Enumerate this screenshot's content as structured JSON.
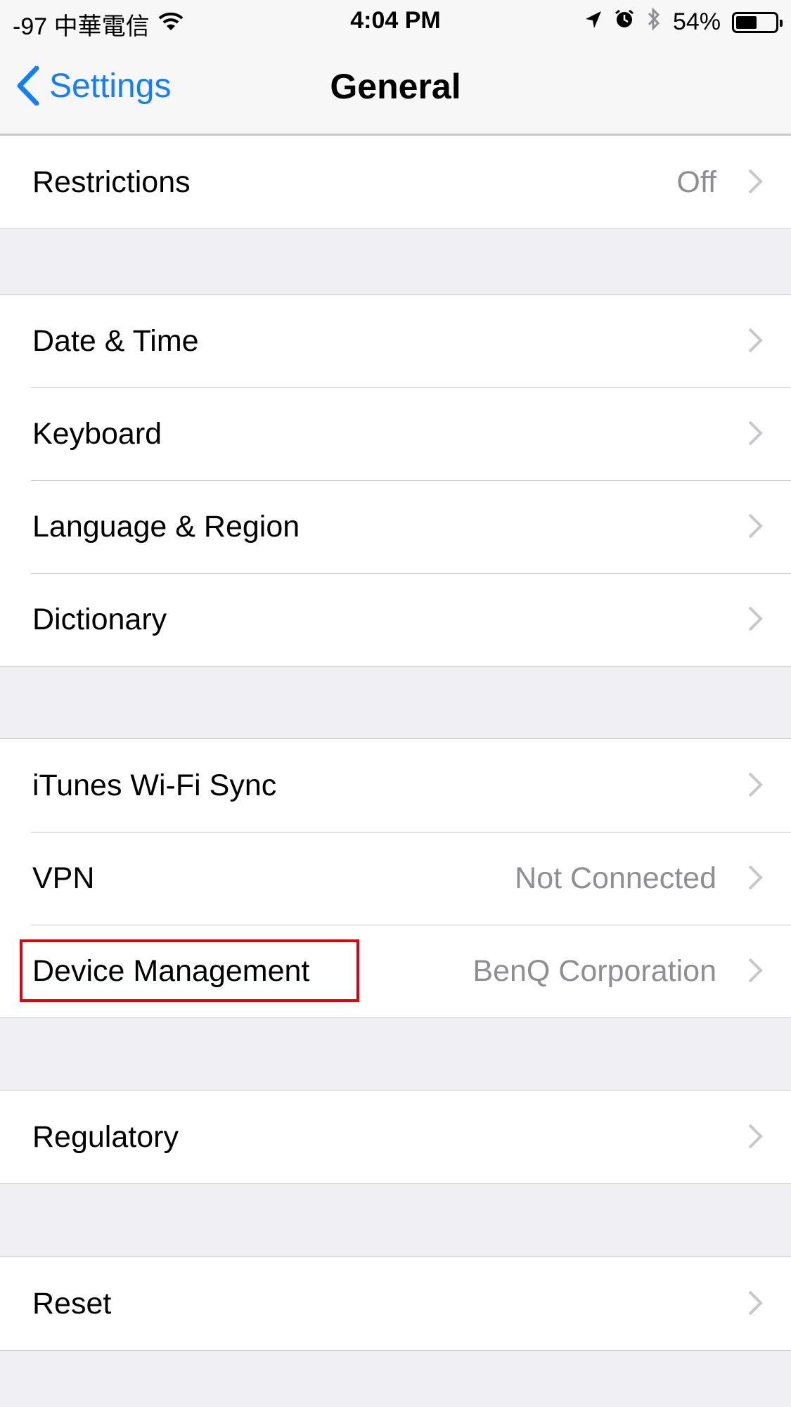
{
  "status_bar": {
    "carrier": "-97 中華電信",
    "time": "4:04 PM",
    "battery": "54%",
    "battery_level": 0.54,
    "icons": [
      "wifi-icon",
      "location-arrow-icon",
      "alarm-icon",
      "bluetooth-icon",
      "battery-icon"
    ]
  },
  "nav": {
    "back_label": "Settings",
    "title": "General"
  },
  "groups": [
    {
      "rows": [
        {
          "label": "Restrictions",
          "detail": "Off"
        }
      ]
    },
    {
      "rows": [
        {
          "label": "Date & Time",
          "detail": ""
        },
        {
          "label": "Keyboard",
          "detail": ""
        },
        {
          "label": "Language & Region",
          "detail": ""
        },
        {
          "label": "Dictionary",
          "detail": ""
        }
      ]
    },
    {
      "rows": [
        {
          "label": "iTunes Wi-Fi Sync",
          "detail": ""
        },
        {
          "label": "VPN",
          "detail": "Not Connected"
        },
        {
          "label": "Device Management",
          "detail": "BenQ Corporation"
        }
      ]
    },
    {
      "rows": [
        {
          "label": "Regulatory",
          "detail": ""
        }
      ]
    },
    {
      "rows": [
        {
          "label": "Reset",
          "detail": ""
        }
      ]
    }
  ],
  "colors": {
    "accent": "#147efb",
    "highlight_box": "#e3000f",
    "background": "#efeff4",
    "detail_text": "#8e8e93"
  }
}
